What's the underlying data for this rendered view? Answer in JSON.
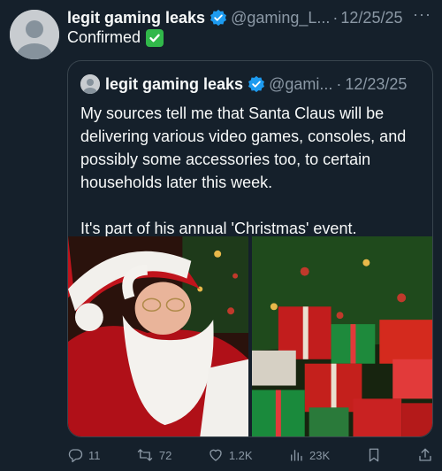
{
  "tweet": {
    "author_name": "legit gaming leaks",
    "handle": "@gaming_L...",
    "separator": "·",
    "date": "12/25/25",
    "more": "···",
    "text": "Confirmed"
  },
  "quoted": {
    "author_name": "legit gaming leaks",
    "handle": "@gami...",
    "separator": "·",
    "date": "12/23/25",
    "paragraph1": "My sources tell me that Santa Claus will be delivering various video games, consoles, and possibly some accessories too, to certain households later this week.",
    "paragraph2": "It's part of his annual 'Christmas' event."
  },
  "actions": {
    "replies": "11",
    "reposts": "72",
    "likes": "1.2K",
    "views": "23K"
  },
  "colors": {
    "background": "#15202b",
    "text": "#f7f9f9",
    "muted": "#8b98a5",
    "verified": "#1d9bf0",
    "border": "#38444d"
  },
  "icons": [
    "verified-badge-icon",
    "check-mark-emoji",
    "reply-icon",
    "repost-icon",
    "like-icon",
    "views-icon",
    "bookmark-icon",
    "share-icon",
    "more-icon"
  ]
}
